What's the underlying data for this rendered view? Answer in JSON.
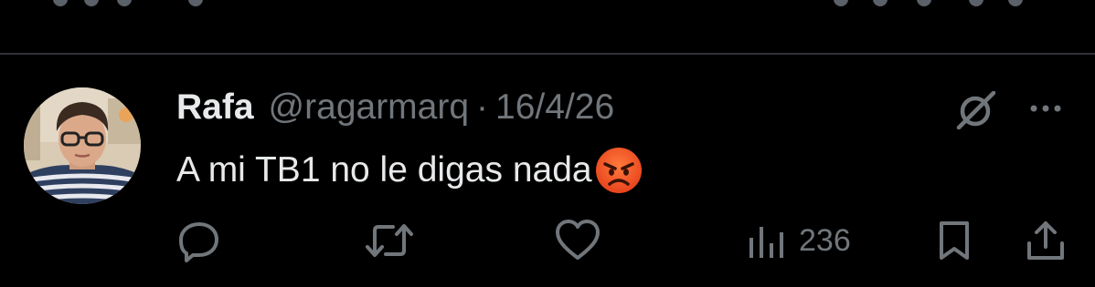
{
  "tweet": {
    "author_name": "Rafa",
    "handle": "@ragarmarq",
    "separator": "·",
    "date": "16/4/26",
    "text": "A mi TB1 no le digas nada",
    "emoji": "angry-face-emoji",
    "views_count": "236"
  },
  "icons": {
    "reply": "reply-icon",
    "retweet": "retweet-icon",
    "like": "heart-icon",
    "views": "views-icon",
    "bookmark": "bookmark-icon",
    "share": "share-icon",
    "grok": "grok-icon",
    "more": "more-icon"
  },
  "colors": {
    "background": "#000000",
    "text_primary": "#e7e9ea",
    "text_secondary": "#71767b",
    "divider": "#2f3336"
  }
}
